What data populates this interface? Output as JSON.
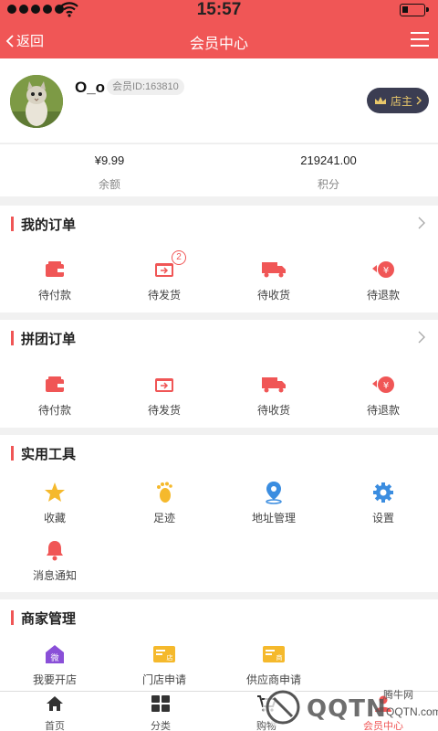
{
  "status": {
    "time": "15:57"
  },
  "nav": {
    "back_label": "返回",
    "title": "会员中心"
  },
  "profile": {
    "username": "O_o",
    "member_id": "会员ID:163810",
    "owner_button": "店主"
  },
  "stats": [
    {
      "value": "¥9.99",
      "label": "余额"
    },
    {
      "value": "219241.00",
      "label": "积分"
    }
  ],
  "my_orders": {
    "title": "我的订单",
    "items": [
      {
        "label": "待付款",
        "icon": "wallet-icon"
      },
      {
        "label": "待发货",
        "icon": "box-icon",
        "badge": "2"
      },
      {
        "label": "待收货",
        "icon": "truck-icon"
      },
      {
        "label": "待退款",
        "icon": "refund-icon"
      }
    ]
  },
  "group_orders": {
    "title": "拼团订单",
    "items": [
      {
        "label": "待付款",
        "icon": "wallet-icon"
      },
      {
        "label": "待发货",
        "icon": "box-icon"
      },
      {
        "label": "待收货",
        "icon": "truck-icon"
      },
      {
        "label": "待退款",
        "icon": "refund-icon"
      }
    ]
  },
  "tools": {
    "title": "实用工具",
    "items": [
      {
        "label": "收藏",
        "icon": "star-icon"
      },
      {
        "label": "足迹",
        "icon": "footprint-icon"
      },
      {
        "label": "地址管理",
        "icon": "location-icon"
      },
      {
        "label": "设置",
        "icon": "gear-icon"
      },
      {
        "label": "消息通知",
        "icon": "bell-icon"
      }
    ]
  },
  "merchant": {
    "title": "商家管理",
    "items": [
      {
        "label": "我要开店",
        "icon": "shop-icon"
      },
      {
        "label": "门店申请",
        "icon": "store-card-icon"
      },
      {
        "label": "供应商申请",
        "icon": "supplier-card-icon"
      }
    ]
  },
  "tabbar": [
    {
      "label": "首页",
      "icon": "home-icon"
    },
    {
      "label": "分类",
      "icon": "grid-icon"
    },
    {
      "label": "购物",
      "icon": "cart-icon"
    },
    {
      "label": "会员中心",
      "icon": "user-icon"
    }
  ],
  "watermark": {
    "text": "腾牛网",
    "brand": "QQTN.com"
  },
  "colors": {
    "primary": "#f05656",
    "gold": "#e8c76a"
  }
}
